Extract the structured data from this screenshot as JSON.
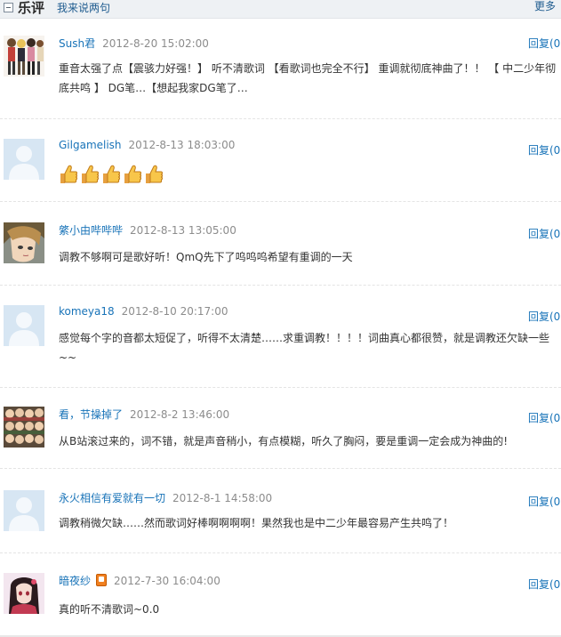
{
  "header": {
    "title": "乐评",
    "subtitle_link": "我来说两句",
    "more_link": "更多"
  },
  "reply_label": "回复(0",
  "comments": [
    {
      "username": "Sush君",
      "time": "2012-8-20 15:02:00",
      "text": "重音太强了点【震骇力好强！】 听不清歌词 【看歌词也完全不行】 重调就彻底神曲了！！ 【 中二少年彻底共鸣 】 DG笔…【想起我家DG笔了…",
      "avatar": "anime-group-avatar"
    },
    {
      "username": "Gilgamelish",
      "time": "2012-8-13 18:03:00",
      "text": "",
      "emoji": [
        "thumbs-up-icon",
        "thumbs-up-icon",
        "thumbs-up-icon",
        "thumbs-up-icon",
        "thumbs-up-icon"
      ],
      "avatar": "default-avatar"
    },
    {
      "username": "綮小由哔哔哔",
      "time": "2012-8-13 13:05:00",
      "text": "调教不够啊可是歌好听！QmQ先下了呜呜呜希望有重调的一天",
      "avatar": "anime-face-avatar"
    },
    {
      "username": "komeya18",
      "time": "2012-8-10 20:17:00",
      "text": "感觉每个字的音都太短促了，听得不太清楚……求重调教！！！！词曲真心都很赞，就是调教还欠缺一些~~",
      "avatar": "default-avatar"
    },
    {
      "username": "看，节操掉了",
      "time": "2012-8-2 13:46:00",
      "text": "从B站滚过来的，词不错，就是声音稍小，有点模糊，听久了胸闷，要是重调一定会成为神曲的!",
      "avatar": "anime-crowd-avatar"
    },
    {
      "username": "永火相信有爱就有一切",
      "time": "2012-8-1 14:58:00",
      "text": "调教稍微欠缺……然而歌词好棒啊啊啊啊！果然我也是中二少年最容易产生共鸣了！",
      "avatar": "default-avatar"
    },
    {
      "username": "暗夜纱",
      "time": "2012-7-30 16:04:00",
      "text": "真的听不清歌词~0.0",
      "badge": "mobile-badge-icon",
      "avatar": "anime-girl-avatar"
    }
  ],
  "colors": {
    "username": "#1873b8",
    "time": "#8c8c8c",
    "text": "#333333",
    "header_bg": "#eef1f4"
  }
}
